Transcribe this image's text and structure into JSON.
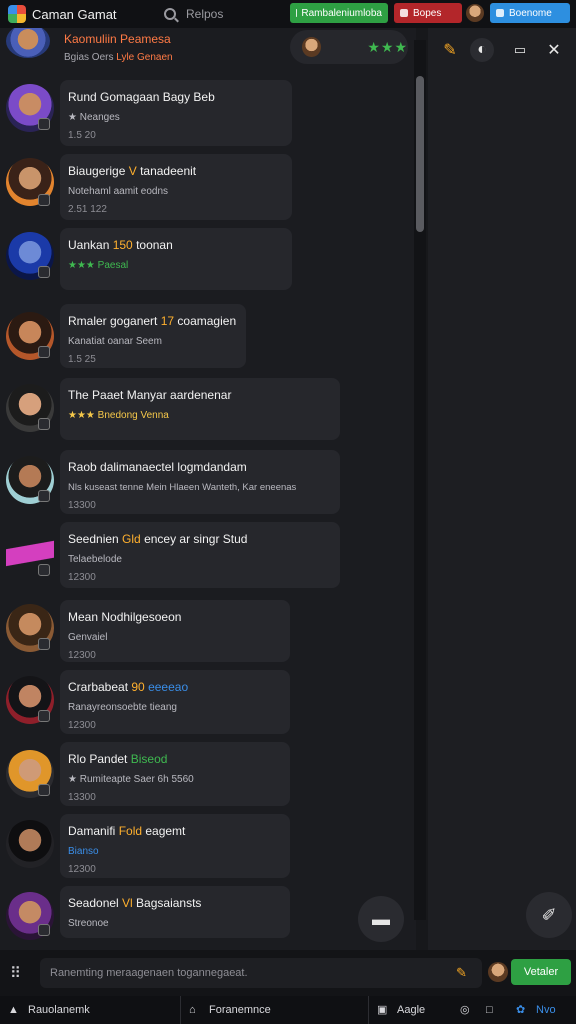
{
  "topbar": {
    "title": "Caman Gamat",
    "search_placeholder": "Relpos",
    "green_label": "Rambaleniumloba",
    "red_label": "Bopes",
    "blue_label": "Boenome"
  },
  "chat_header": {
    "name": "Kaomuliin Peamesa",
    "sub_prefix": "Bgias  Oers",
    "sub_accent": "Lyle Genaen",
    "stars": "★★★"
  },
  "messages": [
    {
      "title_pre": "Rund Gomagaan Bagy Beb",
      "title_hl": "",
      "title_post": "",
      "line2": "★ Neanges",
      "line3": "1.5 20"
    },
    {
      "title_pre": "Biaugerige ",
      "title_hl": "V",
      "title_post": " tanadeenit",
      "line2": "Notehaml aamit eodns",
      "line3": "2.51 122"
    },
    {
      "title_pre": "Uankan ",
      "title_hl": "150",
      "title_post": " toonan",
      "line2": "★★★ Paesal",
      "line3": ""
    },
    {
      "title_pre": "Rmaler goganert ",
      "title_hl": "17",
      "title_post": " coamagien",
      "line2": "Kanatiat oanar Seem",
      "line3": "1.5 25"
    },
    {
      "title_pre": "The Paaet Manyar aardenenar",
      "title_hl": "",
      "title_post": "",
      "line2": "★★★ Bnedong Venna",
      "line3": ""
    },
    {
      "title_pre": "Raob dalimanaectel logmdandam",
      "title_hl": "",
      "title_post": "",
      "line2": "Nls kuseast tenne Mein Hlaeen Wanteth, Kar eneenas",
      "line3": "13300"
    },
    {
      "title_pre": "Seednien ",
      "title_hl": "Gld",
      "title_post": " encey ar singr Stud",
      "line2": "Telaebelode",
      "line3": "12300"
    },
    {
      "title_pre": "Mean Nodhilgesoeon",
      "title_hl": "",
      "title_post": "",
      "line2": "Genvaiel",
      "line3": "12300"
    },
    {
      "title_pre": "Crarbabeat ",
      "title_hl": "90",
      "title_post": " eeeeao",
      "line2": "Ranayreonsoebte tieang",
      "line3": "12300"
    },
    {
      "title_pre": "Rlo Pandet ",
      "title_hl": "Biseod",
      "title_post": "",
      "line2": "★ Rumiteapte Saer 6h 5560",
      "line3": "13300"
    },
    {
      "title_pre": "Damanifi ",
      "title_hl": "Fold",
      "title_post": " eagemt",
      "line2": "Bianso",
      "line3": "12300"
    },
    {
      "title_pre": "Seadonel ",
      "title_hl": "Vl",
      "title_post": " Bagsaiansts",
      "line2": "Streonoe",
      "line3": ""
    }
  ],
  "composer": {
    "placeholder": "Ranemting meraagenaen togannegaeat.",
    "send_label": "Vetaler"
  },
  "taskbar": {
    "task1": "Rauolanemk",
    "task2": "Foranemnce",
    "task3": "Aagle",
    "task4": "Nvo"
  }
}
